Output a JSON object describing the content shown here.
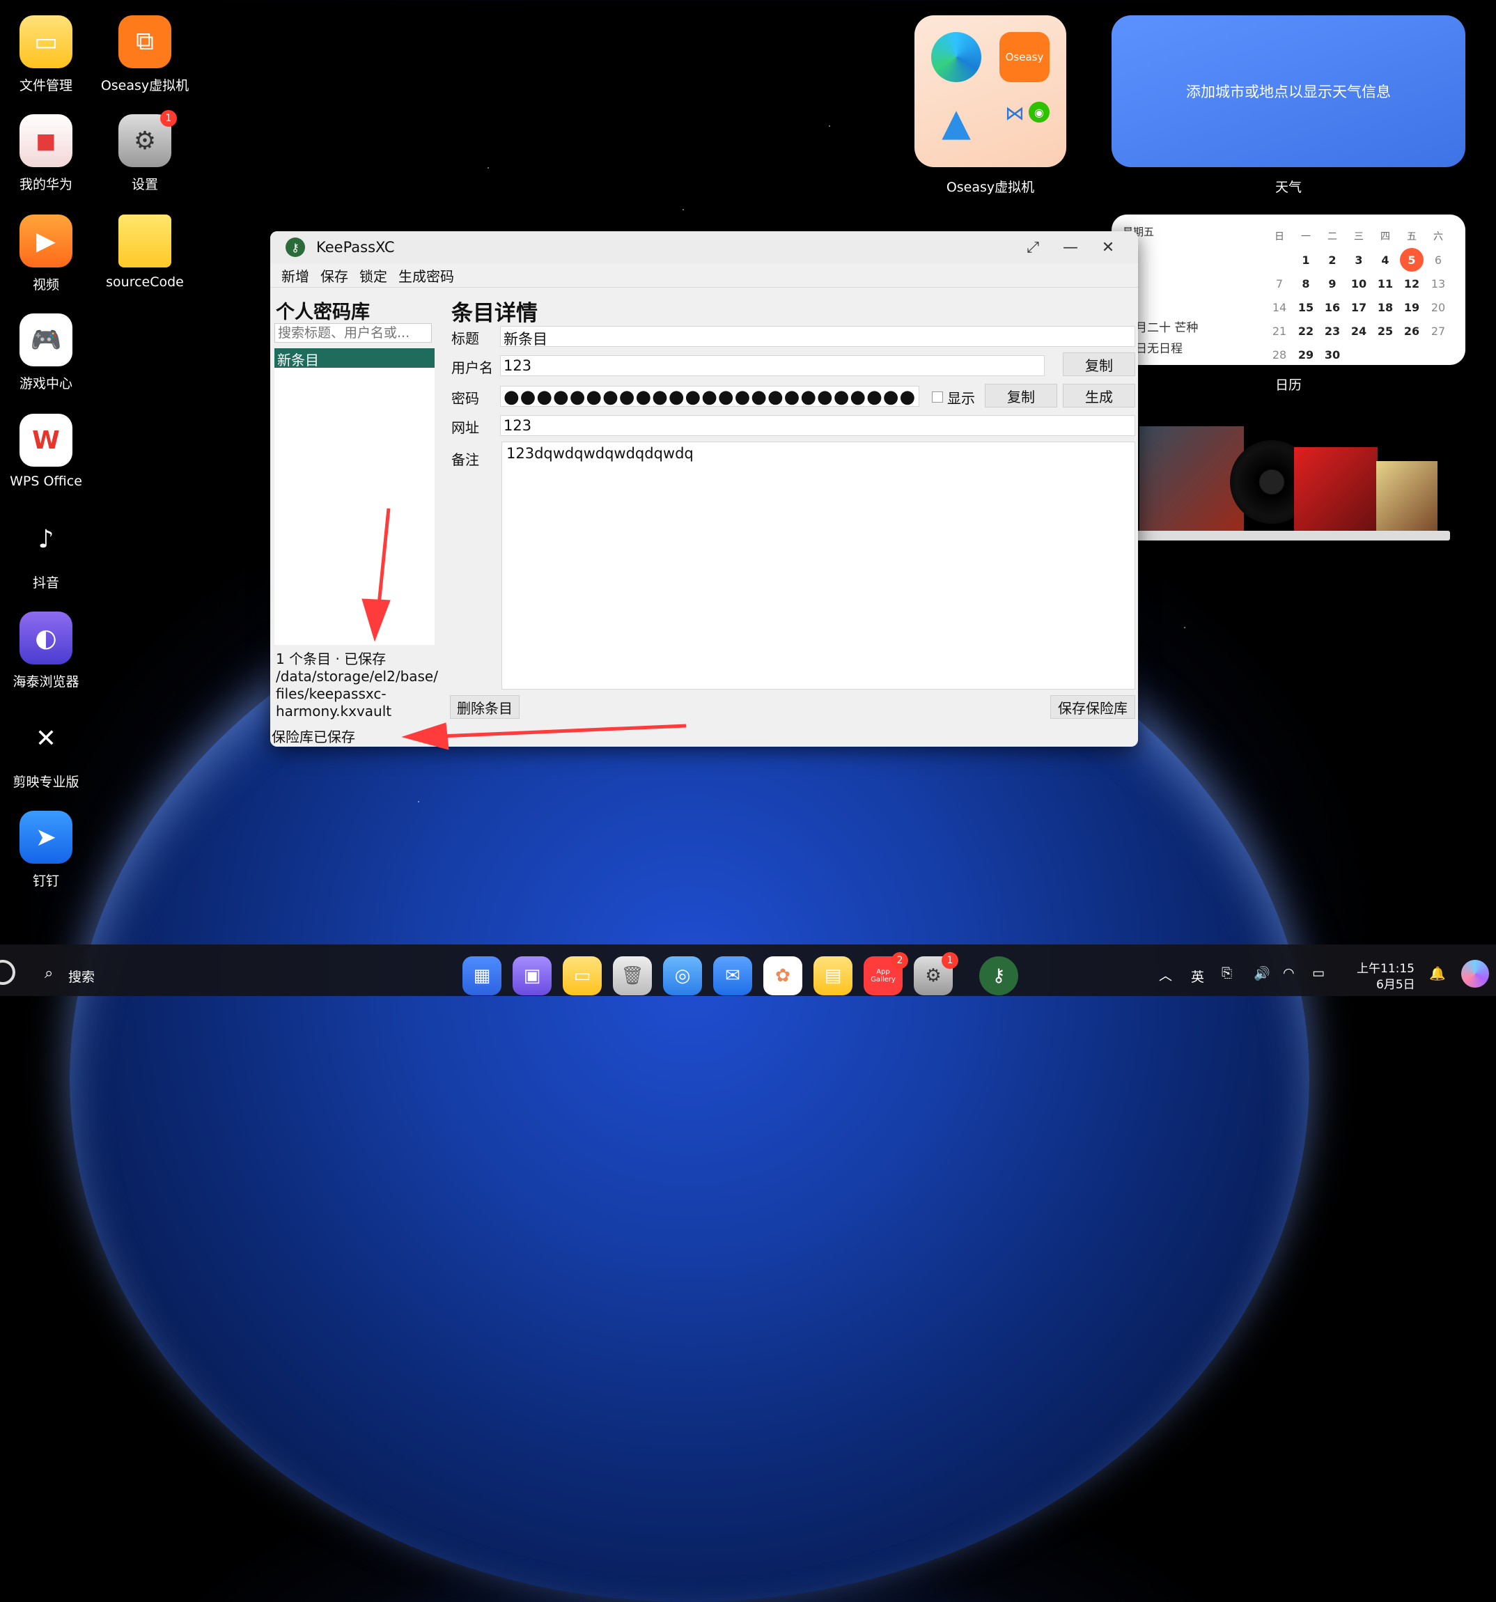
{
  "desktop": {
    "icons": [
      {
        "label": "文件管理"
      },
      {
        "label": "Oseasy虚拟机"
      },
      {
        "label": "我的华为"
      },
      {
        "label": "设置",
        "badge": "1"
      },
      {
        "label": "视频"
      },
      {
        "label": "sourceCode"
      },
      {
        "label": "游戏中心"
      },
      {
        "label": "WPS Office"
      },
      {
        "label": "抖音"
      },
      {
        "label": "海泰浏览器"
      },
      {
        "label": "剪映专业版"
      },
      {
        "label": "钉钉"
      }
    ]
  },
  "widgets": {
    "folder_label": "Oseasy虚拟机",
    "folder_badge": "Oseasy",
    "weather_text": "添加城市或地点以显示天气信息",
    "weather_label": "天气",
    "calendar_label": "日历",
    "calendar": {
      "weekday_title": "星期五",
      "lunar": "月二十 芒种",
      "schedule": "日无日程",
      "headers": [
        "日",
        "一",
        "二",
        "三",
        "四",
        "五",
        "六"
      ],
      "rows": [
        [
          "",
          "1",
          "2",
          "3",
          "4",
          "5",
          "6"
        ],
        [
          "7",
          "8",
          "9",
          "10",
          "11",
          "12",
          "13"
        ],
        [
          "14",
          "15",
          "16",
          "17",
          "18",
          "19",
          "20"
        ],
        [
          "21",
          "22",
          "23",
          "24",
          "25",
          "26",
          "27"
        ],
        [
          "28",
          "29",
          "30",
          "",
          "",
          "",
          ""
        ]
      ],
      "today": "5"
    }
  },
  "keepass": {
    "window_title": "KeePassXC",
    "menu": [
      "新增",
      "保存",
      "锁定",
      "生成密码"
    ],
    "vault_title": "个人密码库",
    "search_placeholder": "搜索标题、用户名或...",
    "entries": [
      "新条目"
    ],
    "status_info": "1 个条目 · 已保存\n/data/storage/el2/base/\nfiles/keepassxc-\nharmony.kxvault",
    "status_bottom": "保险库已保存",
    "detail_title": "条目详情",
    "labels": {
      "title": "标题",
      "username": "用户名",
      "password": "密码",
      "url": "网址",
      "notes": "备注"
    },
    "values": {
      "title": "新条目",
      "username": "123",
      "password": "●●●●●●●●●●●●●●●●●●●●●●●●●",
      "url": "123",
      "notes": "123dqwdqwdqwdqdqwdq"
    },
    "show_label": "显示",
    "copy_label": "复制",
    "generate_label": "生成",
    "delete_label": "删除条目",
    "save_vault_label": "保存保险库"
  },
  "taskbar": {
    "search_label": "搜索",
    "ime": "英",
    "time": "上午11:15",
    "date": "6月5日",
    "badges": {
      "appgallery": "2",
      "settings": "1"
    },
    "appgallery_text": "App Gallery"
  },
  "colors": {
    "selection": "#1f6b5c",
    "badge": "#ff3b30",
    "arrow": "#ff3b3b",
    "today": "#ff5a36"
  }
}
